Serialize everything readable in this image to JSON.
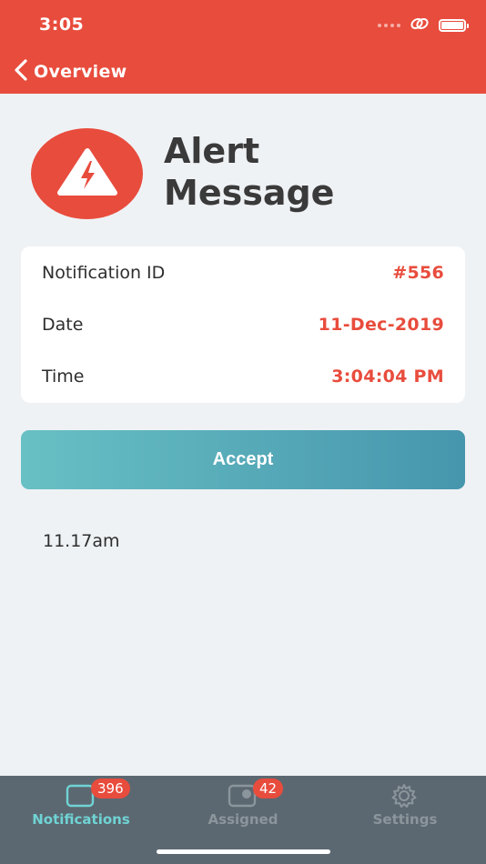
{
  "status_bar": {
    "time": "3:05"
  },
  "header": {
    "back_label": "Overview",
    "back_icon": "chevron-left-icon"
  },
  "alert": {
    "title_line1": "Alert",
    "title_line2": "Message",
    "icon": "warning-lightning-icon"
  },
  "details": [
    {
      "label": "Notification ID",
      "value": "#556"
    },
    {
      "label": "Date",
      "value": "11-Dec-2019"
    },
    {
      "label": "Time",
      "value": "3:04:04 PM"
    }
  ],
  "accept_button": {
    "label": "Accept"
  },
  "note_text": "11.17am",
  "tabs": [
    {
      "label": "Notifications",
      "badge": "396",
      "icon": "notifications-icon",
      "active": true
    },
    {
      "label": "Assigned",
      "badge": "42",
      "icon": "assigned-icon",
      "active": false
    },
    {
      "label": "Settings",
      "badge": "",
      "icon": "gear-icon",
      "active": false
    }
  ],
  "colors": {
    "primary_red": "#e84c3d",
    "accent_teal": "#6fd3d4",
    "tab_bar": "#5c6871",
    "button_gradient_start": "#68c0c4",
    "button_gradient_end": "#4696ad"
  }
}
